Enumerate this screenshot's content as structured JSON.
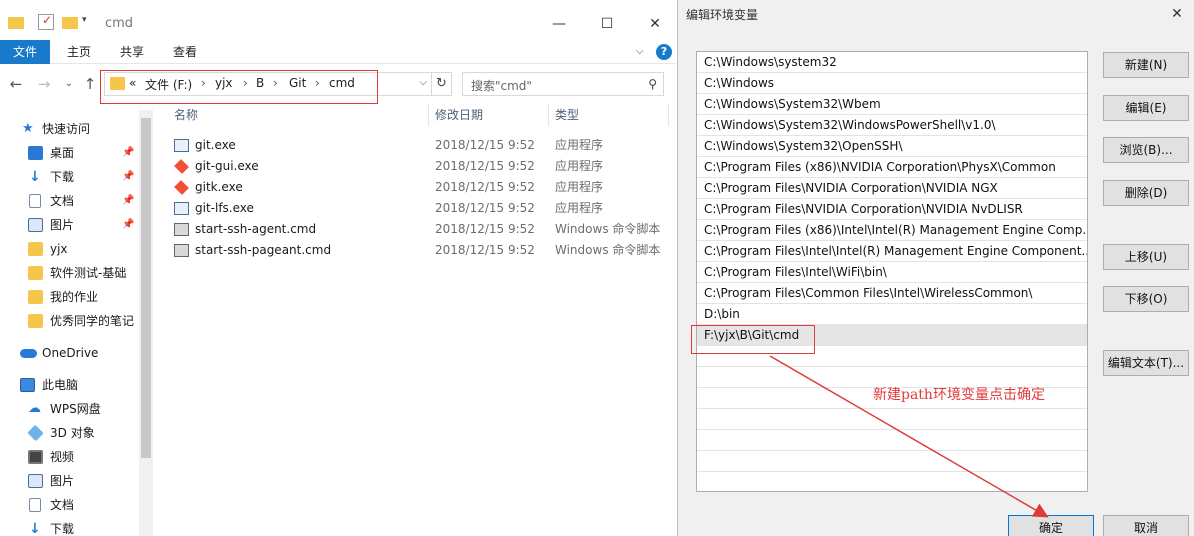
{
  "explorer": {
    "window_title": "cmd",
    "ribbon_tabs": [
      {
        "label": "文件",
        "active": true
      },
      {
        "label": "主页",
        "active": false
      },
      {
        "label": "共享",
        "active": false
      },
      {
        "label": "查看",
        "active": false
      }
    ],
    "help_label": "?",
    "address": {
      "overflow": "«",
      "segments": [
        "文件 (F:)",
        "yjx",
        "B",
        "Git",
        "cmd"
      ]
    },
    "search_placeholder": "搜索\"cmd\"",
    "sidebar": [
      {
        "label": "快速访问",
        "icon": "star-icon",
        "pinned": false
      },
      {
        "label": "桌面",
        "icon": "desktop-icon",
        "pinned": true
      },
      {
        "label": "下载",
        "icon": "download-icon",
        "pinned": true
      },
      {
        "label": "文档",
        "icon": "document-icon",
        "pinned": true
      },
      {
        "label": "图片",
        "icon": "picture-icon",
        "pinned": true
      },
      {
        "label": "yjx",
        "icon": "folder-icon",
        "pinned": false
      },
      {
        "label": "软件测试-基础",
        "icon": "folder-icon",
        "pinned": false
      },
      {
        "label": "我的作业",
        "icon": "folder-icon",
        "pinned": false
      },
      {
        "label": "优秀同学的笔记",
        "icon": "folder-icon",
        "pinned": false
      },
      {
        "label": "OneDrive",
        "icon": "cloud-icon",
        "pinned": false
      },
      {
        "label": "此电脑",
        "icon": "computer-icon",
        "pinned": false
      },
      {
        "label": "WPS网盘",
        "icon": "cloud-drive-icon",
        "pinned": false
      },
      {
        "label": "3D 对象",
        "icon": "3d-object-icon",
        "pinned": false
      },
      {
        "label": "视频",
        "icon": "video-icon",
        "pinned": false
      },
      {
        "label": "图片",
        "icon": "picture-icon",
        "pinned": false
      },
      {
        "label": "文档",
        "icon": "document-icon",
        "pinned": false
      },
      {
        "label": "下载",
        "icon": "download-icon",
        "pinned": false
      }
    ],
    "columns": {
      "name": "名称",
      "date": "修改日期",
      "type": "类型"
    },
    "files": [
      {
        "name": "git.exe",
        "date": "2018/12/15 9:52",
        "type": "应用程序",
        "icon": "exe-icon"
      },
      {
        "name": "git-gui.exe",
        "date": "2018/12/15 9:52",
        "type": "应用程序",
        "icon": "git-icon"
      },
      {
        "name": "gitk.exe",
        "date": "2018/12/15 9:52",
        "type": "应用程序",
        "icon": "git-icon"
      },
      {
        "name": "git-lfs.exe",
        "date": "2018/12/15 9:52",
        "type": "应用程序",
        "icon": "exe-icon"
      },
      {
        "name": "start-ssh-agent.cmd",
        "date": "2018/12/15 9:52",
        "type": "Windows 命令脚本",
        "icon": "cmd-script-icon"
      },
      {
        "name": "start-ssh-pageant.cmd",
        "date": "2018/12/15 9:52",
        "type": "Windows 命令脚本",
        "icon": "cmd-script-icon"
      }
    ]
  },
  "env_dialog": {
    "title": "编辑环境变量",
    "paths": [
      "C:\\Windows\\system32",
      "C:\\Windows",
      "C:\\Windows\\System32\\Wbem",
      "C:\\Windows\\System32\\WindowsPowerShell\\v1.0\\",
      "C:\\Windows\\System32\\OpenSSH\\",
      "C:\\Program Files (x86)\\NVIDIA Corporation\\PhysX\\Common",
      "C:\\Program Files\\NVIDIA Corporation\\NVIDIA NGX",
      "C:\\Program Files\\NVIDIA Corporation\\NVIDIA NvDLISR",
      "C:\\Program Files (x86)\\Intel\\Intel(R) Management Engine Comp...",
      "C:\\Program Files\\Intel\\Intel(R) Management Engine Component...",
      "C:\\Program Files\\Intel\\WiFi\\bin\\",
      "C:\\Program Files\\Common Files\\Intel\\WirelessCommon\\",
      "D:\\bin",
      "F:\\yjx\\B\\Git\\cmd"
    ],
    "selected_index": 13,
    "buttons": {
      "new": "新建(N)",
      "edit": "编辑(E)",
      "browse": "浏览(B)...",
      "delete": "删除(D)",
      "up": "上移(U)",
      "down": "下移(O)",
      "edit_text": "编辑文本(T)...",
      "ok": "确定",
      "cancel": "取消"
    },
    "annotation": "新建path环境变量点击确定",
    "annotation_color": "#e03a3a"
  }
}
